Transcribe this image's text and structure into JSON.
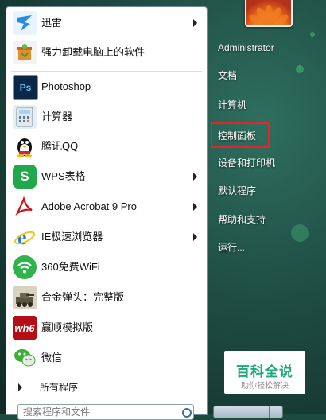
{
  "start_menu": {
    "pinned_items": [
      {
        "label": "迅雷",
        "icon": "xunlei-icon",
        "has_submenu": true
      },
      {
        "label": "强力卸载电脑上的软件",
        "icon": "uninstall-icon",
        "has_submenu": false
      }
    ],
    "recent_items": [
      {
        "label": "Photoshop",
        "icon": "photoshop-icon",
        "has_submenu": false
      },
      {
        "label": "计算器",
        "icon": "calculator-icon",
        "has_submenu": false
      },
      {
        "label": "腾讯QQ",
        "icon": "qq-penguin-icon",
        "has_submenu": false
      },
      {
        "label": "WPS表格",
        "icon": "wps-sheet-icon",
        "has_submenu": true
      },
      {
        "label": "Adobe Acrobat 9 Pro",
        "icon": "acrobat-icon",
        "has_submenu": true
      },
      {
        "label": "IE极速浏览器",
        "icon": "ie-icon",
        "has_submenu": true
      },
      {
        "label": "360免费WiFi",
        "icon": "wifi-icon",
        "has_submenu": false
      },
      {
        "label": "合金弹头：完整版",
        "icon": "metal-slug-icon",
        "has_submenu": false
      },
      {
        "label": "赢顺模拟版",
        "icon": "wh6-icon",
        "has_submenu": false
      },
      {
        "label": "微信",
        "icon": "wechat-icon",
        "has_submenu": false
      }
    ],
    "all_programs_label": "所有程序",
    "search_placeholder": "搜索程序和文件",
    "user_picture": "flower-avatar",
    "right_items": [
      {
        "label": "Administrator"
      },
      {
        "label": "文档"
      },
      {
        "label": "计算机"
      },
      {
        "label": "控制面板",
        "highlighted": true
      },
      {
        "label": "设备和打印机"
      },
      {
        "label": "默认程序"
      },
      {
        "label": "帮助和支持"
      },
      {
        "label": "运行..."
      }
    ],
    "highlight_color": "#e0272a"
  },
  "watermark": {
    "title": "百科全说",
    "subtitle": "助你轻松解决"
  }
}
